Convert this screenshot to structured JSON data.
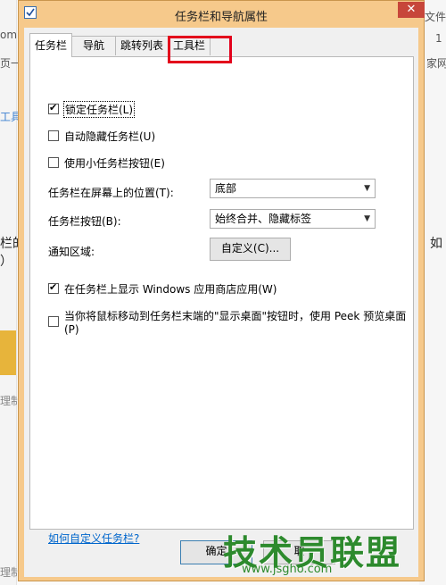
{
  "window": {
    "title": "任务栏和导航属性",
    "close_label": "✕"
  },
  "background": {
    "left_fragments": [
      "om",
      "页一",
      "工具",
      "栏的",
      "）",
      "理制",
      "理制"
    ],
    "right_fragments": [
      "文件",
      "1",
      "家网",
      "如"
    ]
  },
  "tabs": [
    {
      "label": "任务栏",
      "active": true
    },
    {
      "label": "导航",
      "active": false
    },
    {
      "label": "跳转列表",
      "active": false
    },
    {
      "label": "工具栏",
      "active": false,
      "highlighted": true
    }
  ],
  "options": {
    "lock_taskbar": {
      "label": "锁定任务栏(L)",
      "checked": true
    },
    "auto_hide": {
      "label": "自动隐藏任务栏(U)",
      "checked": false
    },
    "small_buttons": {
      "label": "使用小任务栏按钮(E)",
      "checked": false
    }
  },
  "position": {
    "label": "任务栏在屏幕上的位置(T):",
    "value": "底部"
  },
  "buttons_setting": {
    "label": "任务栏按钮(B):",
    "value": "始终合并、隐藏标签"
  },
  "notification": {
    "label": "通知区域:",
    "button": "自定义(C)..."
  },
  "store_apps": {
    "label": "在任务栏上显示 Windows 应用商店应用(W)",
    "checked": true
  },
  "peek": {
    "label": "当你将鼠标移动到任务栏末端的\"显示桌面\"按钮时，使用 Peek 预览桌面(P)",
    "checked": false
  },
  "help_link": "如何自定义任务栏?",
  "footer": {
    "ok": "确定",
    "cancel": "取"
  },
  "watermark": {
    "brand": "技术员联盟",
    "url": "www.jsgho.com"
  }
}
